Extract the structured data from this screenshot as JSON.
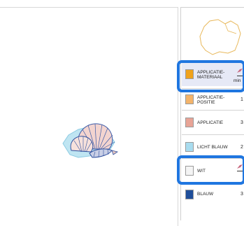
{
  "threads": [
    {
      "label": "APPLICATIE-\nMATERIAAL",
      "color": "#f0a21a",
      "extra": "min",
      "selected": true
    },
    {
      "label": "APPLICATIE-\nPOSITIE",
      "color": "#f4b46a",
      "number": "1"
    },
    {
      "label": "APPLICATIE",
      "color": "#e8a496",
      "number": "3"
    },
    {
      "label": "LICHT BLAUW",
      "color": "#a8dcef",
      "number": "2"
    },
    {
      "label": "WIT",
      "color": "#f4f4f4",
      "selected_outline": true
    },
    {
      "label": "BLAUW",
      "color": "#1f4e9a",
      "number": "3"
    }
  ],
  "colors": {
    "highlight": "#1f76e0",
    "selected_row_bg": "#e6e9f6"
  }
}
